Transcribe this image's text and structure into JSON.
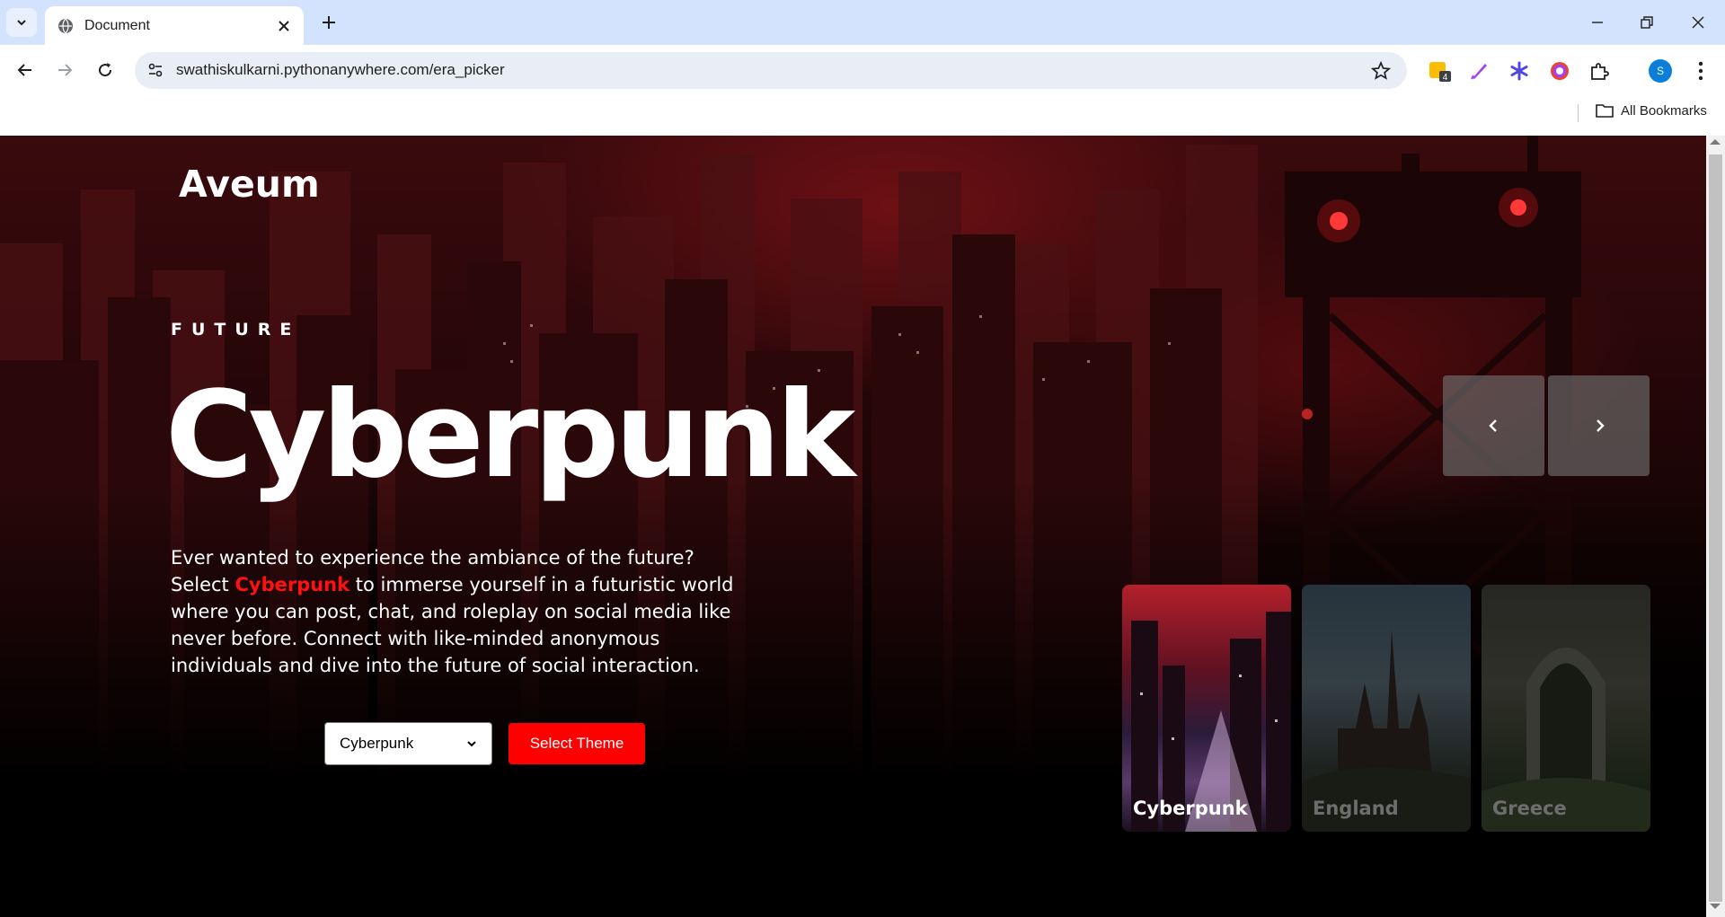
{
  "browser": {
    "tab_title": "Document",
    "url": "swathiskulkarni.pythonanywhere.com/era_picker",
    "all_bookmarks": "All Bookmarks",
    "extension_badge": "4",
    "profile_initial": "S"
  },
  "page": {
    "brand": "Aveum",
    "era_kicker": "FUTURE",
    "era_title": "Cyberpunk",
    "description": {
      "before": "Ever wanted to experience the ambiance of the future? Select ",
      "highlight": "Cyberpunk",
      "after": " to immerse yourself in a futuristic world where you can post, chat, and roleplay on social media like never before. Connect with like-minded anonymous individuals and dive into the future of social interaction."
    },
    "theme_select": {
      "value": "Cyberpunk"
    },
    "select_button": "Select Theme",
    "cards": [
      {
        "label": "Cyberpunk",
        "active": true
      },
      {
        "label": "England",
        "active": false
      },
      {
        "label": "Greece",
        "active": false
      }
    ]
  },
  "colors": {
    "accent": "#ff0000",
    "highlight": "#ff1111",
    "tabstrip": "#d3e3fd"
  }
}
